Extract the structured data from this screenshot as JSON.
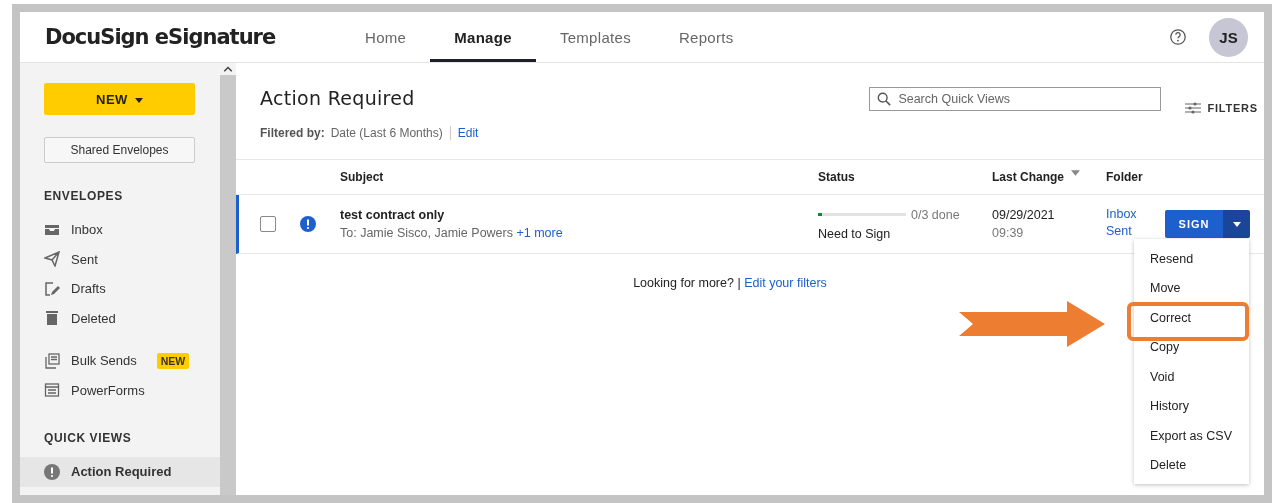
{
  "header": {
    "logo": "DocuSign eSignature",
    "nav": [
      {
        "label": "Home",
        "selected": false
      },
      {
        "label": "Manage",
        "selected": true
      },
      {
        "label": "Templates",
        "selected": false
      },
      {
        "label": "Reports",
        "selected": false
      }
    ],
    "avatar": "JS"
  },
  "sidebar": {
    "new_button": "NEW",
    "shared_button": "Shared Envelopes",
    "sections": [
      {
        "heading": "ENVELOPES",
        "groups": [
          [
            {
              "label": "Inbox",
              "kind": "inbox",
              "selected": false
            },
            {
              "label": "Sent",
              "kind": "sent",
              "selected": false
            },
            {
              "label": "Drafts",
              "kind": "drafts",
              "selected": false
            },
            {
              "label": "Deleted",
              "kind": "deleted",
              "selected": false
            }
          ],
          [
            {
              "label": "Bulk Sends",
              "kind": "bulk",
              "badge": "NEW",
              "selected": false
            },
            {
              "label": "PowerForms",
              "kind": "forms",
              "selected": false
            }
          ]
        ]
      },
      {
        "heading": "QUICK VIEWS",
        "groups": [
          [
            {
              "label": "Action Required",
              "kind": "action",
              "selected": true
            }
          ]
        ]
      }
    ]
  },
  "main": {
    "title": "Action Required",
    "search": {
      "placeholder": "Search Quick Views"
    },
    "filters_button": "FILTERS",
    "filter": {
      "label": "Filtered by:",
      "value": "Date (Last 6 Months)",
      "edit": "Edit"
    },
    "table": {
      "columns": [
        "Subject",
        "Status",
        "Last Change",
        "Folder"
      ],
      "rows": [
        {
          "selected": true,
          "checked": false,
          "subject": "test contract only",
          "recipients": "To: Jamie Sisco, Jamie Powers",
          "more": "+1 more",
          "level": 0.04,
          "progress": "0/3 done",
          "status": "Need to Sign",
          "date": "09/29/2021",
          "time": "09:39",
          "folders": [
            "Inbox",
            "Sent"
          ],
          "action": "SIGN"
        }
      ]
    },
    "footer": {
      "text": "Looking for more? |",
      "link": "Edit your filters"
    },
    "menu": [
      {
        "label": "Resend",
        "annotated": false
      },
      {
        "label": "Move",
        "annotated": false
      },
      {
        "label": "Correct",
        "annotated": true
      },
      {
        "label": "Copy",
        "annotated": false
      },
      {
        "label": "Void",
        "annotated": false
      },
      {
        "label": "History",
        "annotated": false
      },
      {
        "label": "Export as CSV",
        "annotated": false
      },
      {
        "label": "Delete",
        "annotated": false
      }
    ]
  }
}
